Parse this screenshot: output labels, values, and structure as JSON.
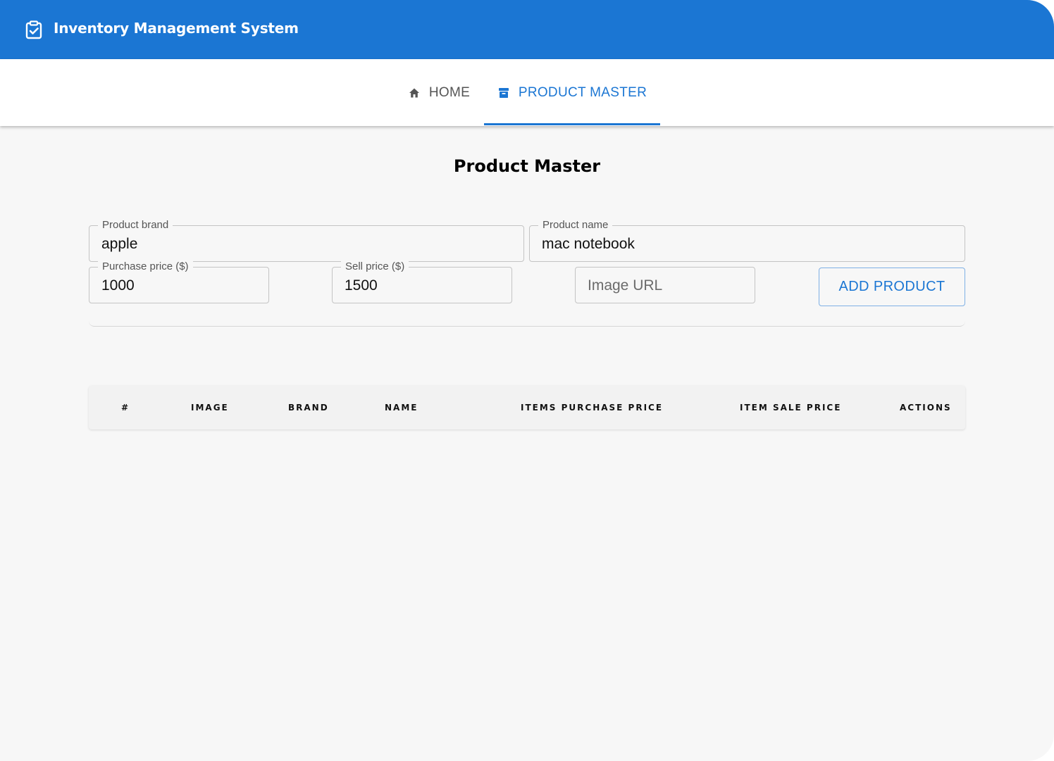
{
  "app": {
    "title": "Inventory Management System",
    "brand_color": "#1b76d3",
    "logo_icon": "clipboard-check-icon"
  },
  "nav": {
    "tabs": [
      {
        "label": "HOME",
        "icon": "home-icon",
        "active": false
      },
      {
        "label": "PRODUCT MASTER",
        "icon": "archive-box-icon",
        "active": true
      }
    ]
  },
  "page": {
    "title": "Product Master"
  },
  "form": {
    "brand": {
      "label": "Product brand",
      "value": "apple"
    },
    "name": {
      "label": "Product name",
      "value": "mac notebook"
    },
    "purchase_price": {
      "label": "Purchase price ($)",
      "value": "1000"
    },
    "sell_price": {
      "label": "Sell price ($)",
      "value": "1500"
    },
    "image_url": {
      "placeholder": "Image URL",
      "value": ""
    },
    "add_button": "ADD PRODUCT"
  },
  "table": {
    "columns": [
      "#",
      "IMAGE",
      "BRAND",
      "NAME",
      "ITEMS PURCHASE PRICE",
      "ITEM SALE PRICE",
      "ACTIONS"
    ],
    "rows": []
  }
}
